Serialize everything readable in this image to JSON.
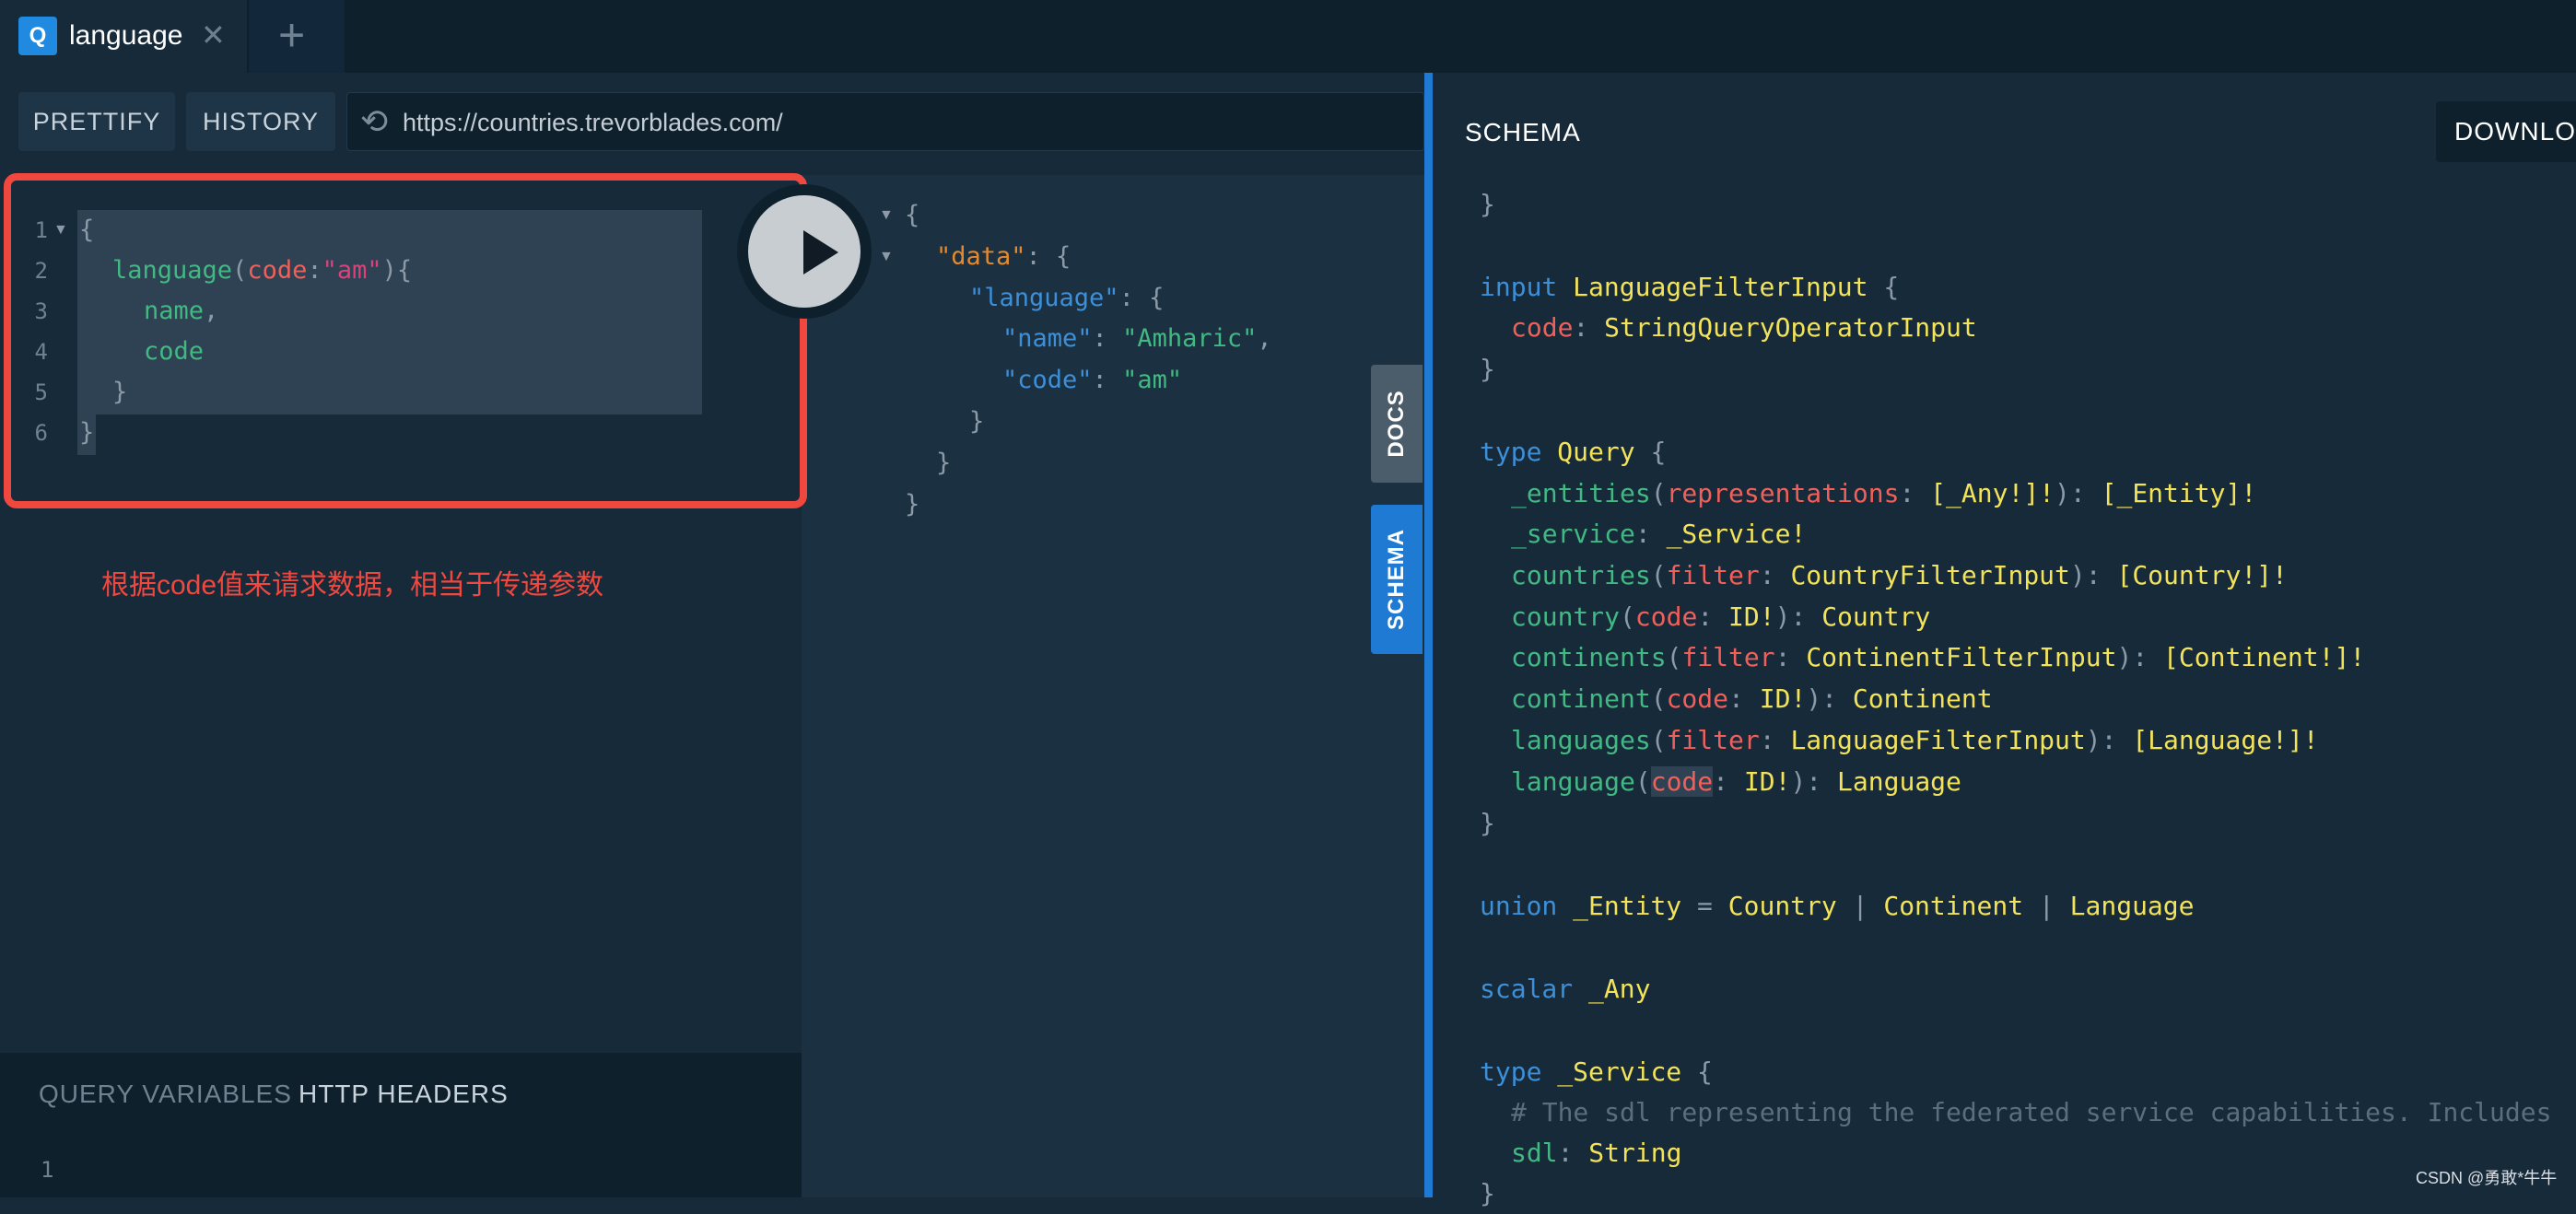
{
  "tab": {
    "icon_letter": "Q",
    "label": "language",
    "close": "✕",
    "add": "+"
  },
  "toolbar": {
    "prettify": "PRETTIFY",
    "history": "HISTORY",
    "url": "https://countries.trevorblades.com/"
  },
  "query": {
    "line_numbers": [
      "1",
      "2",
      "3",
      "4",
      "5",
      "6"
    ],
    "line1": "{",
    "field": "language",
    "arg_name": "code",
    "arg_value": "\"am\"",
    "sub1": "name",
    "sub2": "code",
    "close_inner": "}",
    "close_outer": "}"
  },
  "annotation": "根据code值来请求数据，相当于传递参数",
  "result": {
    "open": "{",
    "data_key": "\"data\"",
    "language_key": "\"language\"",
    "name_key": "\"name\"",
    "name_value": "\"Amharic\"",
    "code_key": "\"code\"",
    "code_value": "\"am\"",
    "close": "}"
  },
  "side_tabs": {
    "docs": "DOCS",
    "schema": "SCHEMA"
  },
  "bottom": {
    "variables": "QUERY VARIABLES",
    "headers": "HTTP HEADERS",
    "line1": "1"
  },
  "schema": {
    "title": "SCHEMA",
    "download": "DOWNLOAD",
    "input_name": "LanguageFilterInput",
    "input_field": "code",
    "input_type": "StringQueryOperatorInput",
    "type_name": "Query",
    "fields": [
      {
        "name": "_entities",
        "arg": "representations",
        "arg_type": "[_Any!]!",
        "ret": "[_Entity]!"
      },
      {
        "name": "_service",
        "ret": "_Service!"
      },
      {
        "name": "countries",
        "arg": "filter",
        "arg_type": "CountryFilterInput",
        "ret": "[Country!]!"
      },
      {
        "name": "country",
        "arg": "code",
        "arg_type": "ID!",
        "ret": "Country"
      },
      {
        "name": "continents",
        "arg": "filter",
        "arg_type": "ContinentFilterInput",
        "ret": "[Continent!]!"
      },
      {
        "name": "continent",
        "arg": "code",
        "arg_type": "ID!",
        "ret": "Continent"
      },
      {
        "name": "languages",
        "arg": "filter",
        "arg_type": "LanguageFilterInput",
        "ret": "[Language!]!"
      },
      {
        "name": "language",
        "arg": "code",
        "arg_type": "ID!",
        "ret": "Language"
      }
    ],
    "union_name": "_Entity",
    "union_members": [
      "Country",
      "Continent",
      "Language"
    ],
    "scalar_name": "_Any",
    "service_type": "_Service",
    "service_comment": "# The sdl representing the federated service capabilities. Includes",
    "service_field": "sdl",
    "service_field_type": "String"
  },
  "watermark": "CSDN @勇敢*牛牛",
  "colors": {
    "accent": "#1f7ad3",
    "annotation": "#f0483e",
    "field": "#42b883",
    "string": "#e0407a",
    "keyword": "#3d8fd8",
    "type": "#f3e35b"
  }
}
